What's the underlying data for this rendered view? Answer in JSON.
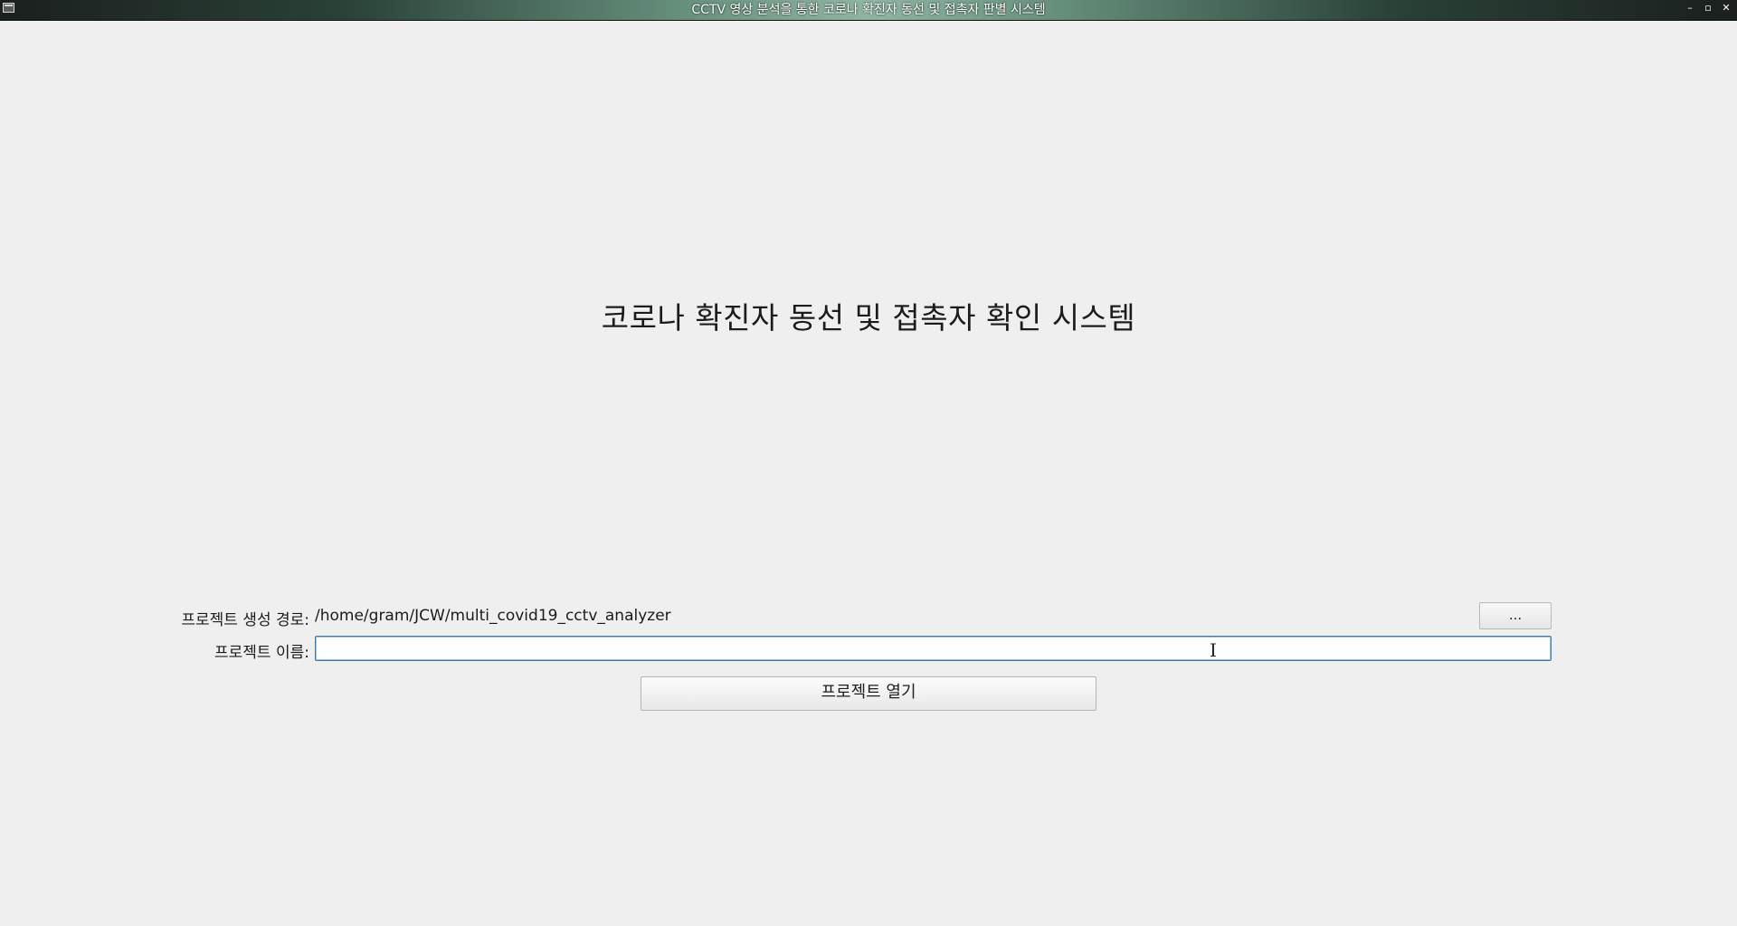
{
  "window": {
    "title": "CCTV 영상 분석을 통한 코로나 확진자 동선 및 접촉자 판별 시스템",
    "controls": {
      "minimize": "–",
      "maximize": "▫",
      "close": "✕"
    }
  },
  "main": {
    "heading": "코로나 확진자 동선 및 접촉자 확인 시스템",
    "path_label": "프로젝트 생성 경로:",
    "path_value": "/home/gram/JCW/multi_covid19_cctv_analyzer",
    "browse_label": "...",
    "name_label": "프로젝트 이름:",
    "name_value": "",
    "open_button": "프로젝트 열기"
  }
}
